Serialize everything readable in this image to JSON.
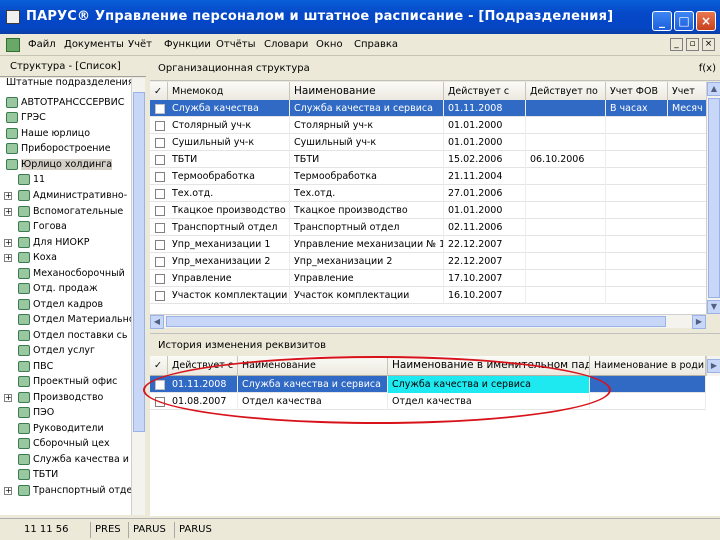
{
  "window": {
    "title": "ПАРУС® Управление персоналом и штатное расписание - [Подразделения]"
  },
  "menu": [
    "Файл",
    "Документы",
    "Учёт",
    "Функции",
    "Отчёты",
    "Словари",
    "Окно",
    "Справка"
  ],
  "left_panel": {
    "header": "Структура - [Список]",
    "items": [
      "Штатные подразделения",
      "АВТОТРАНСССЕРВИС",
      "ГРЭС",
      "Наше юрлицо",
      "Приборостроение",
      "Юрлицо холдинга",
      "11",
      "Административно-",
      "Вспомогательные",
      "Гогова",
      "Для НИОКР",
      "Коха",
      "Механосборочный",
      "Отд. продаж",
      "Отдел кадров",
      "Отдел Материально",
      "Отдел поставки сь",
      "Отдел услуг",
      "ПВС",
      "Проектный офис",
      "Производство",
      "ПЭО",
      "Руководители",
      "Сборочный цех",
      "Служба качества и",
      "ТБТИ",
      "Транспортный отде"
    ]
  },
  "top_grid": {
    "panel_title": "Организационная структура",
    "fx_label": "f(x)",
    "columns": [
      "Мнемокод",
      "Наименование",
      "Действует с",
      "Действует по",
      "Учет ФОВ",
      "Учет"
    ],
    "rows": [
      [
        "Служба качества",
        "Служба качества и сервиса",
        "01.11.2008",
        "",
        "В часах",
        "Месяч"
      ],
      [
        "Столярный уч-к",
        "Столярный уч-к",
        "01.01.2000",
        "",
        "",
        ""
      ],
      [
        "Сушильный уч-к",
        "Сушильный уч-к",
        "01.01.2000",
        "",
        "",
        ""
      ],
      [
        "ТБТИ",
        "ТБТИ",
        "15.02.2006",
        "06.10.2006",
        "",
        ""
      ],
      [
        "Термообработка",
        "Термообработка",
        "21.11.2004",
        "",
        "",
        ""
      ],
      [
        "Тех.отд.",
        "Тех.отд.",
        "27.01.2006",
        "",
        "",
        ""
      ],
      [
        "Ткацкое производство",
        "Ткацкое производство",
        "01.01.2000",
        "",
        "",
        ""
      ],
      [
        "Транспортный отдел",
        "Транспортный отдел",
        "02.11.2006",
        "",
        "",
        ""
      ],
      [
        "Упр_механизации 1",
        "Управление механизации № 1",
        "22.12.2007",
        "",
        "",
        ""
      ],
      [
        "Упр_механизации 2",
        "Упр_механизации 2",
        "22.12.2007",
        "",
        "",
        ""
      ],
      [
        "Управление",
        "Управление",
        "17.10.2007",
        "",
        "",
        ""
      ],
      [
        "Участок комплектации",
        "Участок комплектации",
        "16.10.2007",
        "",
        "",
        ""
      ]
    ]
  },
  "bottom_grid": {
    "panel_title": "История изменения реквизитов",
    "columns": [
      "Действует с",
      "Наименование",
      "Наименование в именительном паде",
      "Наименование в роди"
    ],
    "rows": [
      [
        "01.11.2008",
        "Служба качества и сервиса",
        "Служба качества и сервиса",
        ""
      ],
      [
        "01.08.2007",
        "Отдел качества",
        "Отдел качества",
        ""
      ]
    ]
  },
  "status_bar": [
    "11 11 56",
    "PRES",
    "PARUS",
    "PARUS"
  ],
  "colors": {
    "selection": "#316ac5",
    "highlight_cell": "#1ee8f0",
    "annotation": "#d8121a"
  }
}
